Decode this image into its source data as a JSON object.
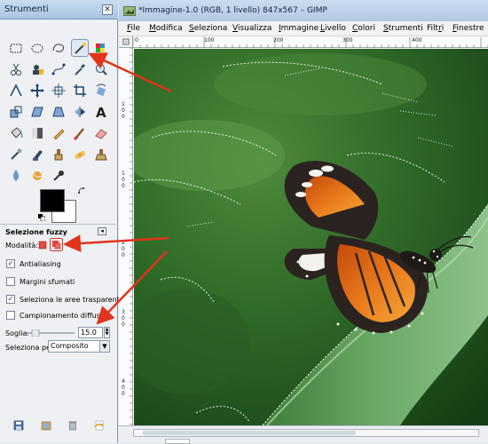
{
  "toolbox": {
    "title": "Strumenti",
    "close_glyph": "✕",
    "tools": [
      {
        "icon": "rect-select-icon"
      },
      {
        "icon": "ellipse-select-icon"
      },
      {
        "icon": "free-select-icon"
      },
      {
        "icon": "fuzzy-select-icon",
        "active": true
      },
      {
        "icon": "color-select-icon"
      },
      {
        "icon": "scissors-select-icon"
      },
      {
        "icon": "foreground-select-icon"
      },
      {
        "icon": "paths-icon"
      },
      {
        "icon": "color-picker-icon"
      },
      {
        "icon": "zoom-icon"
      },
      {
        "icon": "measure-icon"
      },
      {
        "icon": "move-icon"
      },
      {
        "icon": "align-icon"
      },
      {
        "icon": "crop-icon"
      },
      {
        "icon": "rotate-icon"
      },
      {
        "icon": "scale-icon"
      },
      {
        "icon": "shear-icon"
      },
      {
        "icon": "perspective-icon"
      },
      {
        "icon": "flip-icon"
      },
      {
        "icon": "text-icon"
      },
      {
        "icon": "bucket-fill-icon"
      },
      {
        "icon": "blend-icon"
      },
      {
        "icon": "pencil-icon"
      },
      {
        "icon": "paintbrush-icon"
      },
      {
        "icon": "eraser-icon"
      },
      {
        "icon": "airbrush-icon"
      },
      {
        "icon": "ink-icon"
      },
      {
        "icon": "clone-icon"
      },
      {
        "icon": "heal-icon"
      },
      {
        "icon": "perspective-clone-icon"
      },
      {
        "icon": "blur-icon"
      },
      {
        "icon": "smudge-icon"
      },
      {
        "icon": "dodge-burn-icon"
      }
    ],
    "foreground_color": "#000000",
    "background_color": "#ffffff",
    "options": {
      "title": "Selezione fuzzy",
      "mode_label": "Modalità:",
      "antialiasing": {
        "label": "Antialiasing",
        "checked": true
      },
      "feather": {
        "label": "Margini sfumati",
        "checked": false
      },
      "transparent": {
        "label": "Seleziona le aree trasparenti",
        "checked": true
      },
      "sample_merged": {
        "label": "Campionamento diffuso",
        "checked": false
      },
      "threshold_label": "Soglia:",
      "threshold_value": "15.0",
      "select_by_label": "Seleziona per:",
      "select_by_value": "Composito"
    }
  },
  "image_window": {
    "title": "*Immagine-1.0 (RGB, 1 livello) 847x567 – GIMP",
    "menus": [
      {
        "label": "File",
        "u": 0
      },
      {
        "label": "Modifica",
        "u": 0
      },
      {
        "label": "Seleziona",
        "u": 0
      },
      {
        "label": "Visualizza",
        "u": 0
      },
      {
        "label": "Immagine",
        "u": 0
      },
      {
        "label": "Livello",
        "u": 0
      },
      {
        "label": "Colori",
        "u": 0
      },
      {
        "label": "Strumenti",
        "u": 0
      },
      {
        "label": "Filtri",
        "u": 4
      },
      {
        "label": "Finestre",
        "u": 0
      }
    ],
    "ruler_h_labels": [
      "0",
      "100",
      "200",
      "300",
      "400"
    ],
    "ruler_v_labels": [
      "1",
      "0",
      "0",
      "1",
      "0",
      "0",
      "2",
      "0",
      "0",
      "3",
      "0",
      "0",
      "4",
      "0",
      "0"
    ]
  },
  "colors": {
    "arrow": "#e0341c",
    "canvas_dark": "#1d4a1a",
    "leaf": "#5a9a52"
  }
}
